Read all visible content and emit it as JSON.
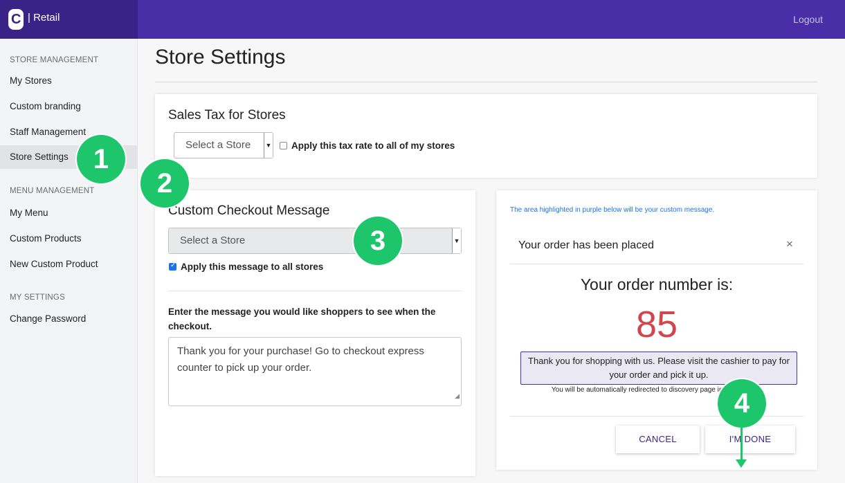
{
  "topbar": {
    "logo_letter": "C",
    "brand_text": "| Retail",
    "logout_label": "Logout"
  },
  "sidebar": {
    "sections": [
      {
        "title": "STORE MANAGEMENT"
      },
      {
        "title": "MENU MANAGEMENT"
      },
      {
        "title": "MY SETTINGS"
      }
    ],
    "items": [
      {
        "label": "My Stores"
      },
      {
        "label": "Custom branding"
      },
      {
        "label": "Staff Management"
      },
      {
        "label": "Store Settings"
      },
      {
        "label": "My Menu"
      },
      {
        "label": "Custom Products"
      },
      {
        "label": "New Custom Product"
      },
      {
        "label": "Change Password"
      }
    ],
    "active_item": "Store Settings"
  },
  "page": {
    "title": "Store Settings"
  },
  "sales_tax": {
    "heading": "Sales Tax for Stores",
    "select_value": "Select a Store",
    "apply_label": "Apply this tax rate to all of my stores",
    "apply_checked": false
  },
  "checkout": {
    "heading": "Custom Checkout Message",
    "select_value": "Select a Store",
    "apply_label": "Apply this message to all stores",
    "apply_checked": true,
    "prompt": "Enter the message you would like shoppers to see when the checkout.",
    "message_value": "Thank you for your purchase! Go to checkout express counter to pick up your order."
  },
  "preview": {
    "note": "The area highlighted in purple below will be your custom message.",
    "modal_title": "Your order has been placed",
    "close_glyph": "×",
    "order_label": "Your order number is:",
    "order_number": "85",
    "message": "Thank you for shopping with us. Please visit the cashier to pay for your order and pick it up.",
    "redirect_text": "You will be automatically redirected to discovery page in 10 seconds.",
    "cancel_label": "CANCEL",
    "done_label": "I'M DONE"
  },
  "markers": [
    "1",
    "2",
    "3",
    "4"
  ],
  "colors": {
    "topbar": "#4a2ea8",
    "brand": "#3a2387",
    "marker": "#1ec66b",
    "order_number": "#d0464c",
    "link": "#1a73e8"
  }
}
